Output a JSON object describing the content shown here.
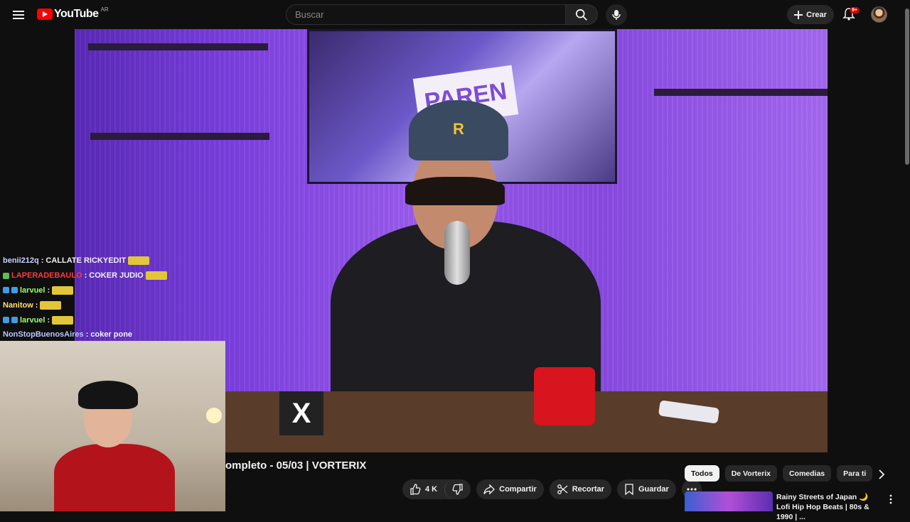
{
  "header": {
    "logo_text": "YouTube",
    "country_code": "AR",
    "search_placeholder": "Buscar",
    "create_label": "Crear",
    "notification_count": "9+"
  },
  "chat": [
    {
      "user": "benii212q",
      "user_color": "#c9d3ff",
      "message": "CALLATE RICKYEDIT",
      "emote": true
    },
    {
      "user": "LAPERADEBAULO",
      "user_color": "#ff3b3b",
      "message": "COKER JUDIO",
      "emote": true
    },
    {
      "user": "larvuel",
      "user_color": "#9cff6a",
      "message": "",
      "emote": true
    },
    {
      "user": "Nanitow",
      "user_color": "#ffe26a",
      "message": "",
      "emote": true
    },
    {
      "user": "larvuel",
      "user_color": "#9cff6a",
      "message": "",
      "emote": true
    },
    {
      "user": "NonStopBuenosAires",
      "user_color": "#b9c7ff",
      "message": "coker pone",
      "emote": false
    }
  ],
  "video": {
    "cap_letter": "R",
    "poster_word": "PAREN",
    "desk_logo": "X"
  },
  "video_title": "ompleto - 05/03 | VORTERIX",
  "actions": {
    "like_count": "4 K",
    "share_label": "Compartir",
    "clip_label": "Recortar",
    "save_label": "Guardar"
  },
  "chips": [
    "Todos",
    "De Vorterix",
    "Comedias",
    "Para ti"
  ],
  "recommendation": {
    "title": "Rainy Streets of Japan 🌙 Lofi Hip Hop Beats | 80s & 1990 | ..."
  },
  "colors": {
    "accent": "#ff0000",
    "background": "#0f0f0f",
    "chip_active": "#f1f1f1"
  }
}
